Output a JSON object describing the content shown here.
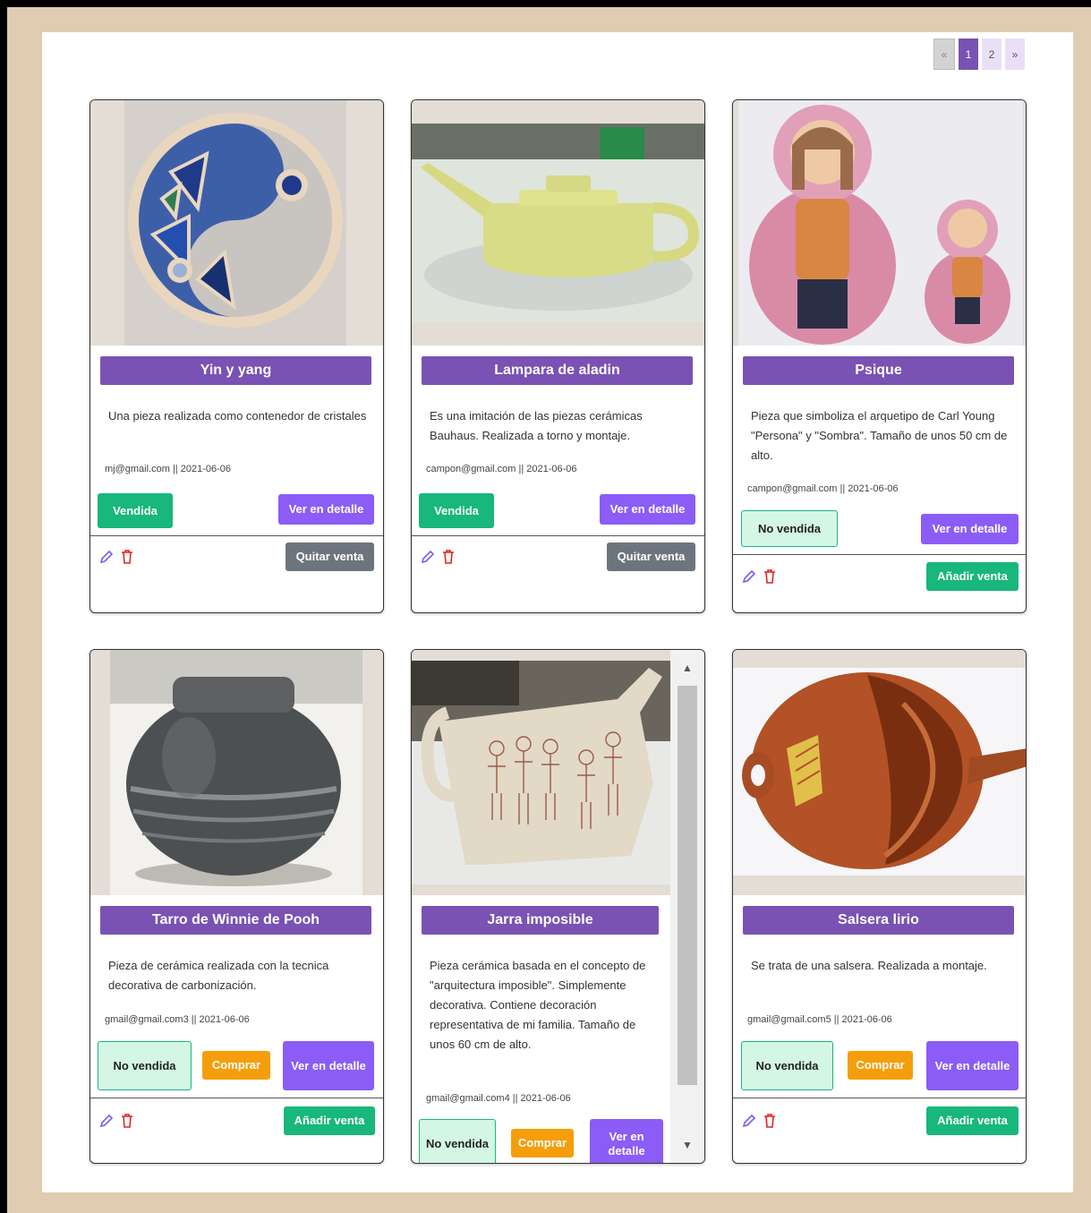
{
  "pagination": {
    "prev": "«",
    "pages": [
      "1",
      "2"
    ],
    "next": "»",
    "active": "1"
  },
  "cards": [
    {
      "title": "Yin y yang",
      "description": "Una pieza realizada como contenedor de cristales",
      "meta": "mj@gmail.com || 2021-06-06",
      "status": "Vendida",
      "detail": "Ver en detalle",
      "action": "Quitar venta"
    },
    {
      "title": "Lampara de aladin",
      "description": "Es una imitación de las piezas cerámicas Bauhaus. Realizada a torno y montaje.",
      "meta": "campon@gmail.com || 2021-06-06",
      "status": "Vendida",
      "detail": "Ver en detalle",
      "action": "Quitar venta"
    },
    {
      "title": "Psique",
      "description": "Pieza que simboliza el arquetipo de Carl Young \"Persona\" y \"Sombra\". Tamaño de unos 50 cm de alto.",
      "meta": "campon@gmail.com || 2021-06-06",
      "status": "No vendida",
      "detail": "Ver en detalle",
      "action": "Añadir venta"
    },
    {
      "title": "Tarro de Winnie de Pooh",
      "description": "Pieza de cerámica realizada con la tecnica decorativa de carbonización.",
      "meta": "gmail@gmail.com3 || 2021-06-06",
      "status": "No vendida",
      "buy": "Comprar",
      "detail": "Ver en detalle",
      "action": "Añadir venta"
    },
    {
      "title": "Jarra imposible",
      "description": "Pieza cerámica basada en el concepto de \"arquitectura imposible\". Simplemente decorativa. Contiene decoración representativa de mi familia. Tamaño de unos 60 cm de alto.",
      "meta": "gmail@gmail.com4 || 2021-06-06",
      "status": "No vendida",
      "buy": "Comprar",
      "detail": "Ver en detalle"
    },
    {
      "title": "Salsera lirio",
      "description": "Se trata de una salsera. Realizada a montaje.",
      "meta": "gmail@gmail.com5 || 2021-06-06",
      "status": "No vendida",
      "buy": "Comprar",
      "detail": "Ver en detalle",
      "action": "Añadir venta"
    }
  ],
  "icons": {
    "edit": "pencil-icon",
    "delete": "trash-icon"
  },
  "colors": {
    "title": "#7952b3",
    "sold": "#18b77b",
    "detail": "#8b5cf6",
    "buy": "#f59e0b",
    "remove": "#6c757d"
  }
}
